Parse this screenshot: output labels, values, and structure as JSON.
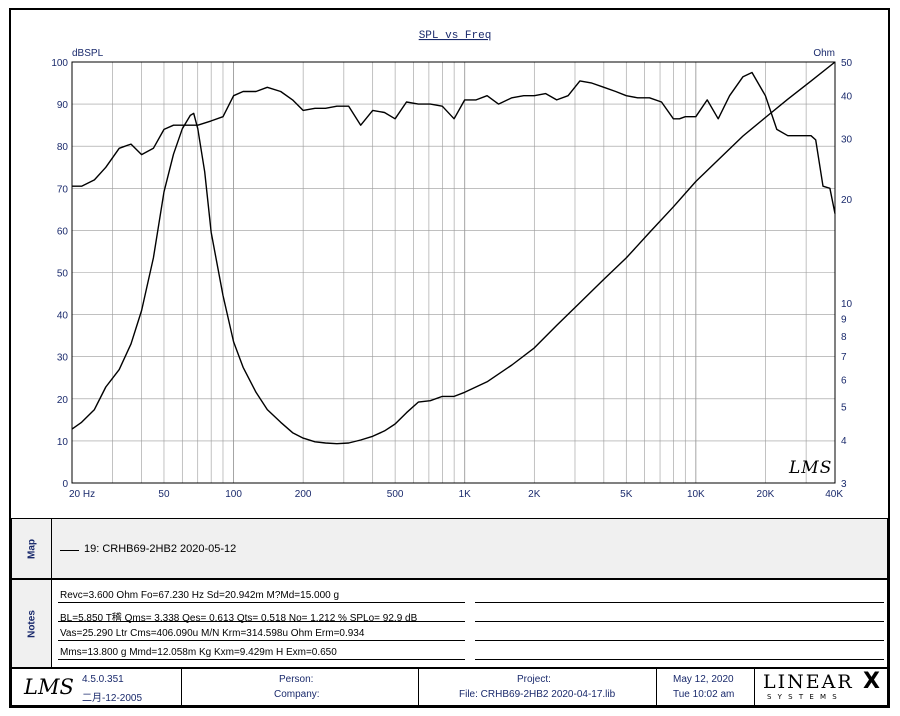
{
  "chart_data": {
    "type": "line",
    "title": "SPL vs Freq",
    "left_axis": {
      "label": "dBSPL",
      "ylim": [
        0,
        100
      ],
      "ticks": [
        "0",
        "10",
        "20",
        "30",
        "40",
        "50",
        "60",
        "70",
        "80",
        "90",
        "100"
      ]
    },
    "right_axis": {
      "label": "Ohm",
      "scale": "log",
      "ylim": [
        3,
        50
      ],
      "ticks": [
        "3",
        "4",
        "5",
        "6",
        "7",
        "8",
        "9",
        "10",
        "20",
        "30",
        "40",
        "50"
      ]
    },
    "x_axis": {
      "scale": "log",
      "xlim": [
        20,
        40000
      ],
      "tick_labels": [
        "20  Hz",
        "50",
        "100",
        "200",
        "500",
        "1K",
        "2K",
        "5K",
        "10K",
        "20K",
        "40K"
      ],
      "tick_values": [
        20,
        50,
        100,
        200,
        500,
        1000,
        2000,
        5000,
        10000,
        20000,
        40000
      ]
    },
    "grid": true,
    "series": [
      {
        "name": "SPL",
        "axis": "left",
        "x": [
          20,
          22,
          25,
          28,
          32,
          36,
          40,
          45,
          50,
          55,
          62,
          70,
          80,
          90,
          100,
          110,
          125,
          140,
          160,
          180,
          200,
          225,
          250,
          280,
          315,
          355,
          400,
          450,
          500,
          560,
          630,
          710,
          800,
          900,
          1000,
          1120,
          1250,
          1400,
          1600,
          1800,
          2000,
          2240,
          2500,
          2800,
          3150,
          3550,
          4000,
          4500,
          5000,
          5600,
          6300,
          7100,
          8000,
          8500,
          9000,
          10000,
          11200,
          12500,
          14000,
          16000,
          17500,
          20000,
          22400,
          25000,
          28000,
          31500,
          33000,
          35500,
          38000,
          40000
        ],
        "y": [
          70.5,
          70.5,
          72,
          75,
          79.5,
          80.5,
          78,
          79.5,
          84,
          85,
          85,
          85,
          86,
          87,
          92,
          93,
          93,
          94,
          93,
          91,
          88.5,
          89,
          89,
          89.5,
          89.5,
          85,
          88.5,
          88,
          86.5,
          90.5,
          90,
          90,
          89.5,
          86.5,
          91,
          91,
          92,
          90,
          91.5,
          92,
          92,
          92.5,
          91,
          92,
          95.5,
          95,
          94,
          93,
          92,
          91.5,
          91.5,
          90.5,
          86.5,
          86.5,
          87,
          87,
          91,
          86.5,
          92,
          96.5,
          97.5,
          92,
          84,
          82.5,
          82.5,
          82.5,
          81.5,
          70.5,
          70,
          64
        ]
      },
      {
        "name": "Impedance",
        "axis": "right",
        "x": [
          20,
          22,
          25,
          28,
          32,
          36,
          40,
          45,
          50,
          55,
          60,
          65,
          67.23,
          70,
          75,
          80,
          90,
          100,
          110,
          125,
          140,
          160,
          180,
          200,
          225,
          250,
          280,
          315,
          355,
          400,
          450,
          500,
          560,
          630,
          710,
          800,
          900,
          1000,
          1250,
          1600,
          2000,
          2500,
          3150,
          4000,
          5000,
          6300,
          8000,
          10000,
          12500,
          16000,
          20000,
          25000,
          31500,
          40000
        ],
        "y": [
          4.3,
          4.5,
          4.9,
          5.7,
          6.4,
          7.6,
          9.5,
          13.5,
          21,
          27,
          32,
          35,
          35.5,
          32,
          24,
          16,
          10.5,
          7.7,
          6.5,
          5.5,
          4.9,
          4.5,
          4.2,
          4.05,
          3.95,
          3.92,
          3.9,
          3.92,
          4.0,
          4.1,
          4.25,
          4.45,
          4.8,
          5.15,
          5.2,
          5.35,
          5.35,
          5.5,
          5.9,
          6.6,
          7.4,
          8.6,
          10.0,
          11.7,
          13.5,
          16.0,
          19.0,
          22.5,
          26,
          30.5,
          34.5,
          39,
          44,
          50
        ]
      }
    ],
    "watermark": "LMS"
  },
  "map": {
    "label": "Map",
    "legend_entry": "19: CRHB69-2HB2 2020-05-12"
  },
  "notes": {
    "label": "Notes",
    "lines": [
      "Revc=3.600 Ohm  Fo=67.230 Hz  Sd=20.942m M?Md=15.000 g",
      "BL=5.850 T稽  Qms= 3.338  Qes= 0.613  Qts= 0.518  No= 1.212 %  SPLo= 92.9 dB",
      "Vas=25.290 Ltr  Cms=406.090u M/N  Krm=314.598u Ohm  Erm=0.934",
      "Mms=13.800 g  Mmd=12.058m Kg  Kxm=9.429m H  Exm=0.650"
    ]
  },
  "footer": {
    "logo": "LMS",
    "version": "4.5.0.351",
    "build_date": "二月-12-2005",
    "person_label": "Person:",
    "company_label": "Company:",
    "project_label": "Project:",
    "file_label": "File: CRHB69-2HB2 2020-04-17.lib",
    "date": "May 12, 2020",
    "time": "Tue 10:02 am",
    "brand": "LINEAR",
    "brand_x": "X",
    "brand_sub": "S Y S T E M S"
  },
  "colors": {
    "label_blue": "#1a2a6c",
    "grid": "#9a9a9a",
    "curve": "#000000",
    "panel_bg": "#f0f0f0"
  }
}
